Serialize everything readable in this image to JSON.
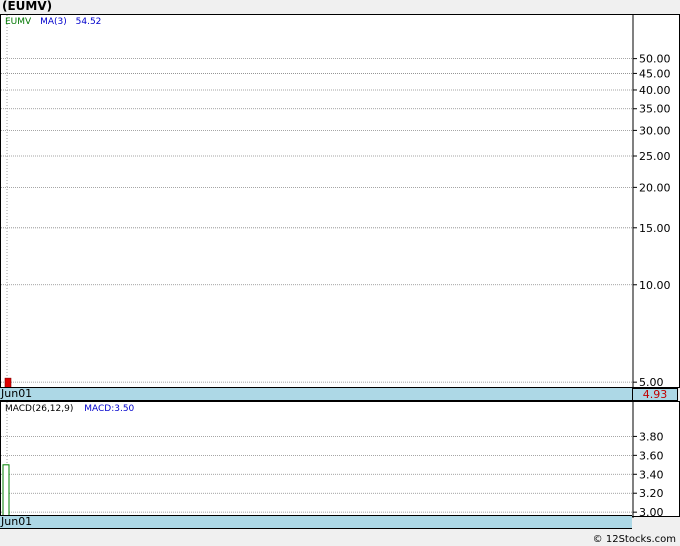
{
  "ticker_title": "(EUMV)",
  "price_panel": {
    "legend": {
      "symbol": "EUMV",
      "ma_label": "MA(3)",
      "ma_value": "54.52"
    },
    "last_price": "4.93",
    "date_label": "Jun01"
  },
  "macd_panel": {
    "legend": {
      "params": "MACD(26,12,9)",
      "value_label": "MACD:3.50"
    },
    "date_label": "Jun01"
  },
  "credit": "© 12Stocks.com",
  "colors": {
    "symbol": "#007700",
    "ma": "#0000cc",
    "price_bar": "#dd0000",
    "macd_bar": "#008000",
    "grid": "#888888",
    "strip": "#add8e6",
    "last_price": "#c00000"
  },
  "chart_data": [
    {
      "type": "bar",
      "name": "price",
      "title": "(EUMV)",
      "x": [
        "Jun01"
      ],
      "values": [
        4.93
      ],
      "scale": "log",
      "ylim": [
        4.9,
        60
      ],
      "yticks": [
        5,
        10,
        15,
        20,
        25,
        30,
        35,
        40,
        45,
        50
      ],
      "ytick_labels": [
        "5.00",
        "10.00",
        "15.00",
        "20.00",
        "25.00",
        "30.00",
        "35.00",
        "40.00",
        "45.00",
        "50.00"
      ],
      "grid": true,
      "legend": {
        "position": "top-left",
        "entries": [
          "EUMV",
          "MA(3) 54.52"
        ]
      }
    },
    {
      "type": "bar",
      "name": "macd",
      "title": "MACD(26,12,9)",
      "x": [
        "Jun01"
      ],
      "values": [
        3.5
      ],
      "ylim": [
        2.97,
        4.1
      ],
      "yticks": [
        3.0,
        3.2,
        3.4,
        3.6,
        3.8
      ],
      "ytick_labels": [
        "3.00",
        "3.20",
        "3.40",
        "3.60",
        "3.80"
      ],
      "grid": true,
      "legend": {
        "position": "top-left",
        "entries": [
          "MACD(26,12,9)",
          "MACD:3.50"
        ]
      }
    }
  ]
}
